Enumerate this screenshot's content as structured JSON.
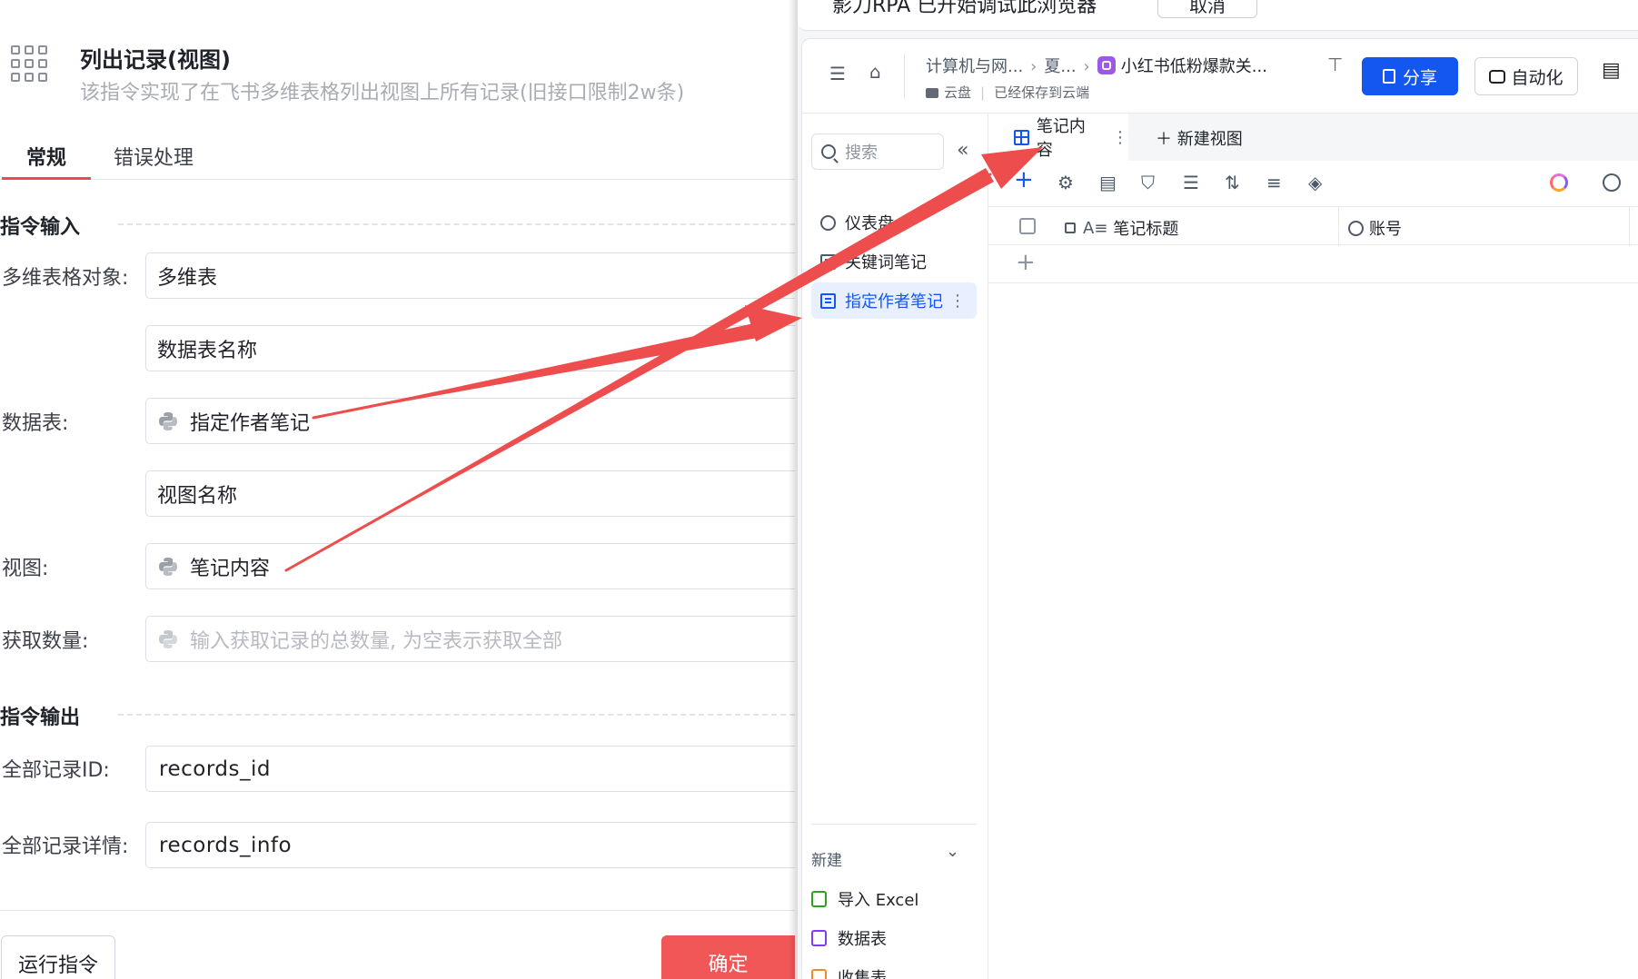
{
  "left": {
    "title": "列出记录(视图)",
    "description": "该指令实现了在飞书多维表格列出视图上所有记录(旧接口限制2w条)",
    "tabs": [
      "常规",
      "错误处理"
    ],
    "input_section": "指令输入",
    "output_section": "指令输出",
    "fields": {
      "table_obj_label": "多维表格对象:",
      "table_obj_value": "多维表",
      "table_name_value": "数据表名称",
      "data_table_label": "数据表:",
      "data_table_value": "指定作者笔记",
      "view_name_value": "视图名称",
      "view_label": "视图:",
      "view_value": "笔记内容",
      "count_label": "获取数量:",
      "count_placeholder": "输入获取记录的总数量, 为空表示获取全部",
      "ids_label": "全部记录ID:",
      "ids_value": "records_id",
      "info_label": "全部记录详情:",
      "info_value": "records_info"
    },
    "run_button": "运行指令",
    "ok_button": "确定"
  },
  "browser": {
    "notify_text": "影刀RPA 已开始调试此浏览器",
    "notify_button": "取消",
    "breadcrumb": [
      "计算机与网...",
      "夏...",
      "小红书低粉爆款关..."
    ],
    "location": "云盘",
    "saved_status": "已经保存到云端",
    "share_button": "分享",
    "auto_button": "自动化",
    "search_placeholder": "搜索",
    "sidebar_items": [
      "仪表盘",
      "关键词笔记",
      "指定作者笔记"
    ],
    "new_label": "新建",
    "new_items": [
      "导入 Excel",
      "数据表",
      "收集表"
    ],
    "view_tab": "笔记内容",
    "new_view": "新建视图",
    "columns": [
      "笔记标题",
      "账号"
    ],
    "colors": {
      "accent": "#1456f0",
      "confirm": "#f25757",
      "arrow": "#ee4d4d"
    }
  }
}
